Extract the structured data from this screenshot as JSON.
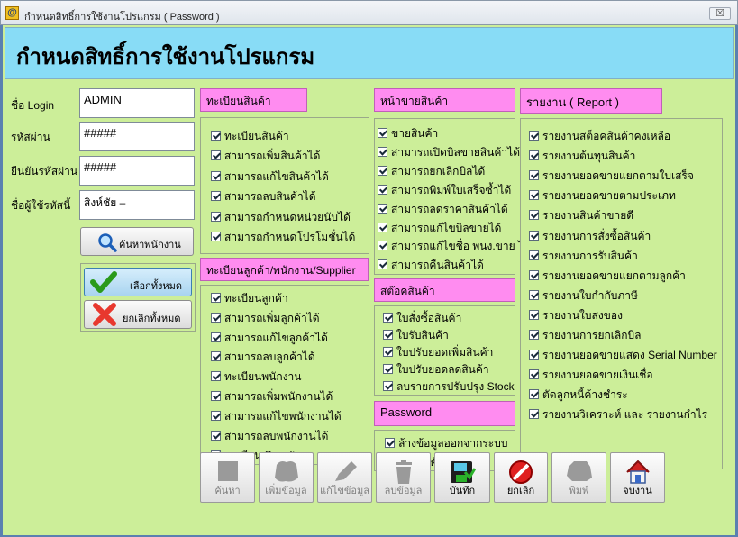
{
  "window": {
    "title": "กำหนดสิทธิ์การใช้งานโปรแกรม ( Password )",
    "close_label": "☒"
  },
  "header": {
    "title": "กำหนดสิทธิ์การใช้งานโปรแกรม"
  },
  "login_form": {
    "login_label": "ชื่อ Login",
    "login_value": "ADMIN",
    "password_label": "รหัสผ่าน",
    "password_value": "#####",
    "confirm_label": "ยืนยันรหัสผ่าน",
    "confirm_value": "#####",
    "owner_label": "ชื่อผู้ใช้รหัสนี้",
    "owner_value": "สิงห์ชัย –",
    "search_employee_label": "ค้นหาพนักงาน",
    "select_all_label": "เลือกทั้งหมด",
    "deselect_all_label": "ยกเลิกทั้งหมด"
  },
  "sections": {
    "products": {
      "header": "ทะเบียนสินค้า",
      "items": [
        "ทะเบียนสินค้า",
        "สามารถเพิ่มสินค้าได้",
        "สามารถแก้ไขสินค้าได้",
        "สามารถลบสินค้าได้",
        "สามารถกำหนดหน่วยนับได้",
        "สามารถกำหนดโปรโมชั่นได้"
      ]
    },
    "customers": {
      "header": "ทะเบียนลูกค้า/พนักงาน/Supplier",
      "items": [
        "ทะเบียนลูกค้า",
        "สามารถเพิ่มลูกค้าได้",
        "สามารถแก้ไขลูกค้าได้",
        "สามารถลบลูกค้าได้",
        "ทะเบียนพนักงาน",
        "สามารถเพิ่มพนักงานได้",
        "สามารถแก้ไขพนักงานได้",
        "สามารถลบพนักงานได้",
        "ทะเบียน Supplier"
      ]
    },
    "sales": {
      "header": "หน้าขายสินค้า",
      "items": [
        "ขายสินค้า",
        "สามารถเปิดบิลขายสินค้าได้",
        "สามารถยกเลิกบิลได้",
        "สามารถพิมพ์ใบเสร็จซ้ำได้",
        "สามารถลดราคาสินค้าได้",
        "สามารถแก้ไขบิลขายได้",
        "สามารถแก้ไขชื่อ พนง.ขาย ได้",
        "สามารถคืนสินค้าได้"
      ]
    },
    "stock": {
      "header": "สต๊อคสินค้า",
      "items": [
        "ใบสั่งซื้อสินค้า",
        "ใบรับสินค้า",
        "ใบปรับยอดเพิ่มสินค้า",
        "ใบปรับยอดลดสินค้า",
        "ลบรายการปรับปรุง Stock"
      ]
    },
    "password": {
      "header": "Password",
      "items": [
        "ล้างข้อมูลออกจากระบบ",
        "ตั้งค่ารหัสผ่าน"
      ]
    },
    "reports": {
      "header": "รายงาน ( Report )",
      "items": [
        "รายงานสต็อคสินค้าคงเหลือ",
        "รายงานต้นทุนสินค้า",
        "รายงานยอดขายแยกตามใบเสร็จ",
        "รายงานยอดขายตามประเภท",
        "รายงานสินค้าขายดี",
        "รายงานการสั่งซื้อสินค้า",
        "รายงานการรับสินค้า",
        "รายงานยอดขายแยกตามลูกค้า",
        "รายงานใบกำกับภาษี",
        "รายงานใบส่งของ",
        "รายงานการยกเลิกบิล",
        "รายงานยอดขายแสดง Serial Number",
        "รายงานยอดขายเงินเชื่อ",
        "ตัดลูกหนี้ค้างชำระ",
        "รายงานวิเคราะห์ และ รายงานกำไร"
      ]
    }
  },
  "toolbar": {
    "search": "ค้นหา",
    "add": "เพิ่มข้อมูล",
    "edit": "แก้ไขข้อมูล",
    "delete": "ลบข้อมูล",
    "save": "บันทึก",
    "cancel": "ยกเลิก",
    "print": "พิมพ์",
    "exit": "จบงาน"
  }
}
